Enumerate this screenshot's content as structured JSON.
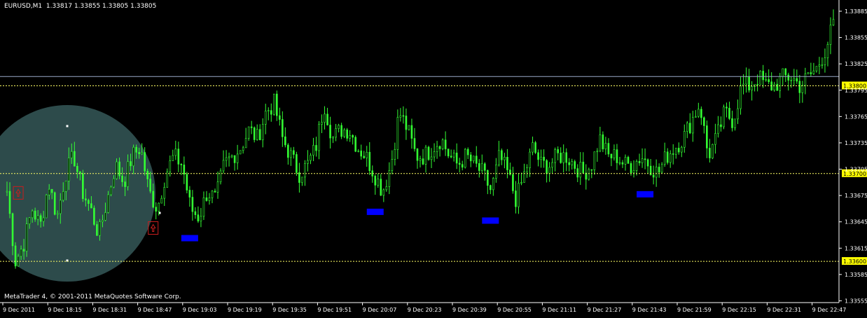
{
  "window": {
    "symbol_timeframe": "EURUSD,M1",
    "ohlc": [
      "1.33817",
      "1.33855",
      "1.33805",
      "1.33805"
    ],
    "copyright": "MetaTrader 4, © 2001-2011 MetaQuotes Software Corp."
  },
  "colors": {
    "background": "#000000",
    "candles": "#33ff33",
    "axis": "#ffffff",
    "level_line": "#ffff66",
    "level_label_bg": "#ffff00",
    "bid_line": "#9aa9c8",
    "marker_blue": "#0000ff",
    "arrow_box": "#c81e1e",
    "circle_fill": "#2f4f4f"
  },
  "chart_data": {
    "type": "candlestick",
    "symbol": "EURUSD",
    "timeframe": "M1",
    "y_range": [
      1.33545,
      1.33885
    ],
    "y_ticks": [
      "1.33885",
      "1.33855",
      "1.33825",
      "1.33795",
      "1.33765",
      "1.33735",
      "1.33705",
      "1.33675",
      "1.33645",
      "1.33615",
      "1.33585",
      "1.33555"
    ],
    "x_ticks": [
      "9 Dec 2011",
      "9 Dec 18:15",
      "9 Dec 18:31",
      "9 Dec 18:47",
      "9 Dec 19:03",
      "9 Dec 19:19",
      "9 Dec 19:35",
      "9 Dec 19:51",
      "9 Dec 20:07",
      "9 Dec 20:23",
      "9 Dec 20:39",
      "9 Dec 20:55",
      "9 Dec 21:11",
      "9 Dec 21:27",
      "9 Dec 21:43",
      "9 Dec 21:59",
      "9 Dec 22:15",
      "9 Dec 22:31",
      "9 Dec 22:47"
    ],
    "levels": [
      {
        "price": 1.338,
        "label": "1.33800"
      },
      {
        "price": 1.337,
        "label": "1.33700"
      },
      {
        "price": 1.336,
        "label": "1.33600"
      }
    ],
    "bid_price": 1.33805,
    "closes": [
      1.3368,
      1.336,
      1.3362,
      1.3366,
      1.3364,
      1.3369,
      1.3365,
      1.337,
      1.3372,
      1.3368,
      1.3366,
      1.3363,
      1.3367,
      1.3371,
      1.3369,
      1.3372,
      1.3373,
      1.3368,
      1.3366,
      1.337,
      1.3372,
      1.3371,
      1.3366,
      1.3365,
      1.3368,
      1.3367,
      1.3371,
      1.3372,
      1.3373,
      1.3375,
      1.3374,
      1.3377,
      1.3378,
      1.3374,
      1.3372,
      1.337,
      1.3371,
      1.3373,
      1.3378,
      1.3374,
      1.3375,
      1.3375,
      1.3373,
      1.3372,
      1.337,
      1.3368,
      1.3371,
      1.3377,
      1.3375,
      1.3372,
      1.3372,
      1.3373,
      1.3374,
      1.3372,
      1.3371,
      1.3372,
      1.3371,
      1.337,
      1.3368,
      1.3372,
      1.337,
      1.3367,
      1.337,
      1.3373,
      1.3371,
      1.3371,
      1.3372,
      1.3372,
      1.3371,
      1.337,
      1.3371,
      1.3374,
      1.3372,
      1.3372,
      1.3371,
      1.3371,
      1.3372,
      1.3371,
      1.337,
      1.3372,
      1.3373,
      1.3374,
      1.3376,
      1.3378,
      1.3372,
      1.3374,
      1.3377,
      1.3376,
      1.338,
      1.338,
      1.3381,
      1.338,
      1.338,
      1.3381,
      1.3381,
      1.338,
      1.3381,
      1.3382,
      1.3384,
      1.3387
    ],
    "buy_arrows": [
      {
        "bar": 4,
        "price": 1.3367
      },
      {
        "bar": 52,
        "price": 1.3363
      }
    ],
    "blue_markers": [
      {
        "bar": 65,
        "price": 1.3363
      },
      {
        "bar": 131,
        "price": 1.3366
      },
      {
        "bar": 172,
        "price": 1.3365
      },
      {
        "bar": 227,
        "price": 1.3368
      }
    ],
    "bar_count": 295
  }
}
